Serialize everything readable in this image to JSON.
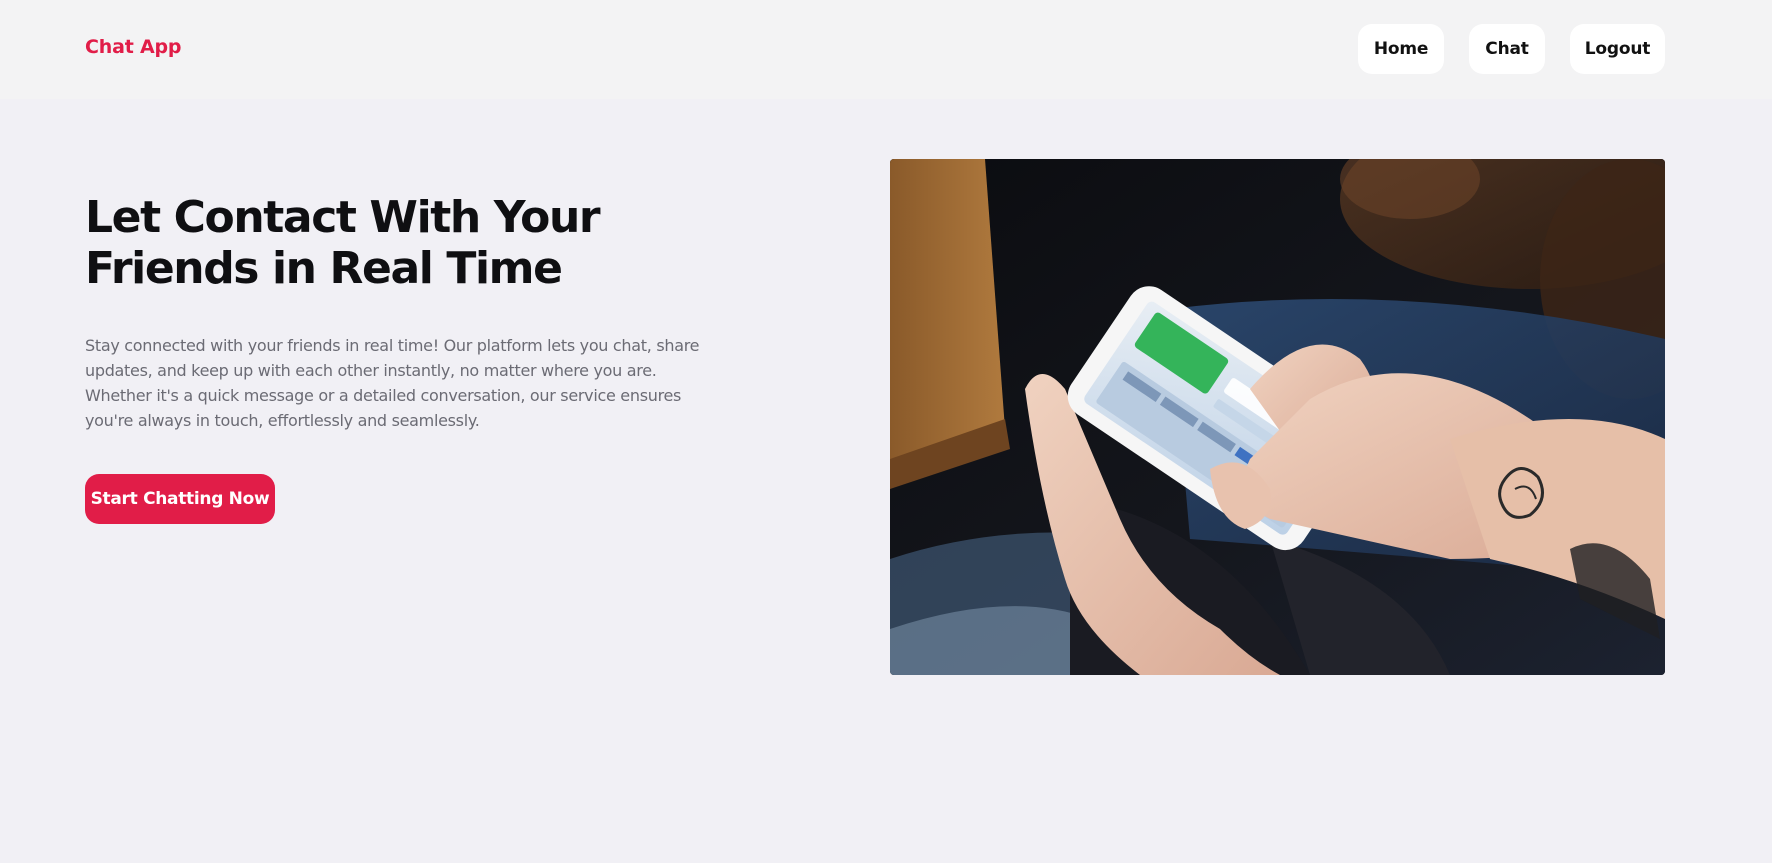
{
  "header": {
    "brand": "Chat App",
    "nav": {
      "home": "Home",
      "chat": "Chat",
      "logout": "Logout"
    }
  },
  "hero": {
    "title_line1": "Let Contact With Your",
    "title_line2": "Friends in Real Time",
    "description": "Stay connected with your friends in real time! Our platform lets you chat, share updates, and keep up with each other instantly, no matter where you are. Whether it's a quick message or a detailed conversation, our service ensures you're always in touch, effortlessly and seamlessly.",
    "cta_label": "Start Chatting Now",
    "image_icon": "photo-hands-typing-on-phone"
  },
  "colors": {
    "accent": "#e11d48",
    "page_bg": "#f1f0f5",
    "header_bg": "#f3f3f4",
    "text_dark": "#0f0f12",
    "text_muted": "#6b6b74"
  }
}
